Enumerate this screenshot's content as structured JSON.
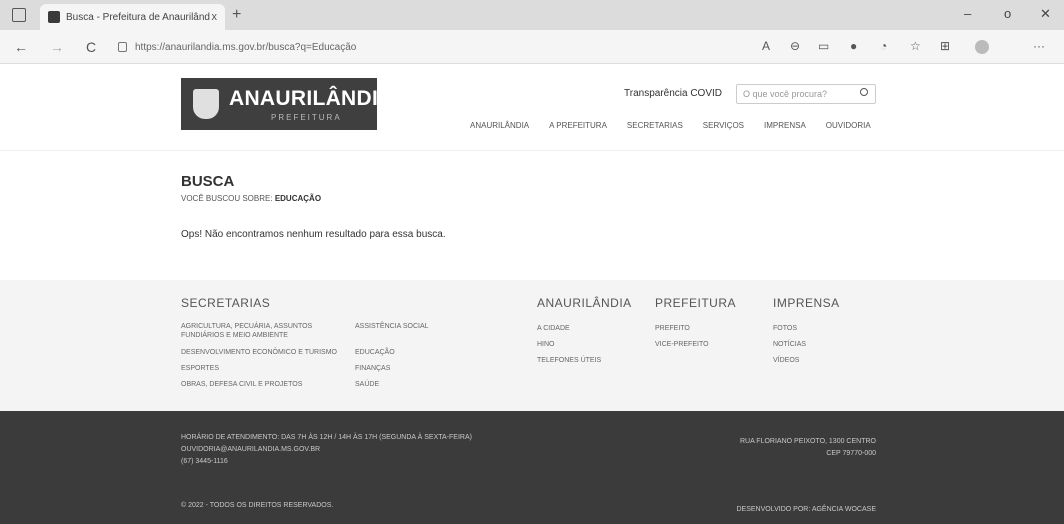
{
  "browser": {
    "tab_title": "Busca - Prefeitura de Anaurilând",
    "tab_close": "x",
    "new_tab": "+",
    "win_min": "–",
    "win_max": "o",
    "win_close": "✕",
    "url": "https://anaurilandia.ms.gov.br/busca?q=Educação",
    "back": "←",
    "forward": "→",
    "reload": "C",
    "more": "···"
  },
  "header": {
    "logo_name": "ANAURILÂNDIA",
    "logo_sub": "PREFEITURA",
    "covid_link": "Transparência COVID",
    "search_placeholder": "O que você procura?",
    "nav": [
      "ANAURILÂNDIA",
      "A PREFEITURA",
      "SECRETARIAS",
      "SERVIÇOS",
      "IMPRENSA",
      "OUVIDORIA"
    ]
  },
  "content": {
    "title": "BUSCA",
    "searched_prefix": "VOCÊ BUSCOU SOBRE:",
    "searched_term": "EDUCAÇÃO",
    "no_result": "Ops! Não encontramos nenhum resultado para essa busca."
  },
  "footer": {
    "secretarias_title": "SECRETARIAS",
    "secretarias_col1": [
      "AGRICULTURA, PECUÁRIA, ASSUNTOS FUNDIÁRIOS E MEIO AMBIENTE",
      "DESENVOLVIMENTO ECONÔMICO E TURISMO",
      "ESPORTES",
      "OBRAS, DEFESA CIVIL E PROJETOS"
    ],
    "secretarias_col2": [
      "ASSISTÊNCIA SOCIAL",
      "EDUCAÇÃO",
      "FINANÇAS",
      "SAÚDE"
    ],
    "anaurilandia_title": "ANAURILÂNDIA",
    "anaurilandia_links": [
      "A CIDADE",
      "HINO",
      "TELEFONES ÚTEIS"
    ],
    "prefeitura_title": "PREFEITURA",
    "prefeitura_links": [
      "PREFEITO",
      "VICE-PREFEITO"
    ],
    "imprensa_title": "IMPRENSA",
    "imprensa_links": [
      "FOTOS",
      "NOTÍCIAS",
      "VÍDEOS"
    ],
    "hours": "HORÁRIO DE ATENDIMENTO: DAS 7H ÀS 12H / 14H ÀS 17H (SEGUNDA À SEXTA-FEIRA)",
    "email": "OUVIDORIA@ANAURILANDIA.MS.GOV.BR",
    "phone": "(67) 3445-1116",
    "address": "RUA FLORIANO PEIXOTO, 1300 CENTRO",
    "cep": "CEP 79770-000",
    "copyright": "© 2022 - TODOS OS DIREITOS RESERVADOS.",
    "developer": "DESENVOLVIDO POR: AGÊNCIA WOCASE"
  }
}
